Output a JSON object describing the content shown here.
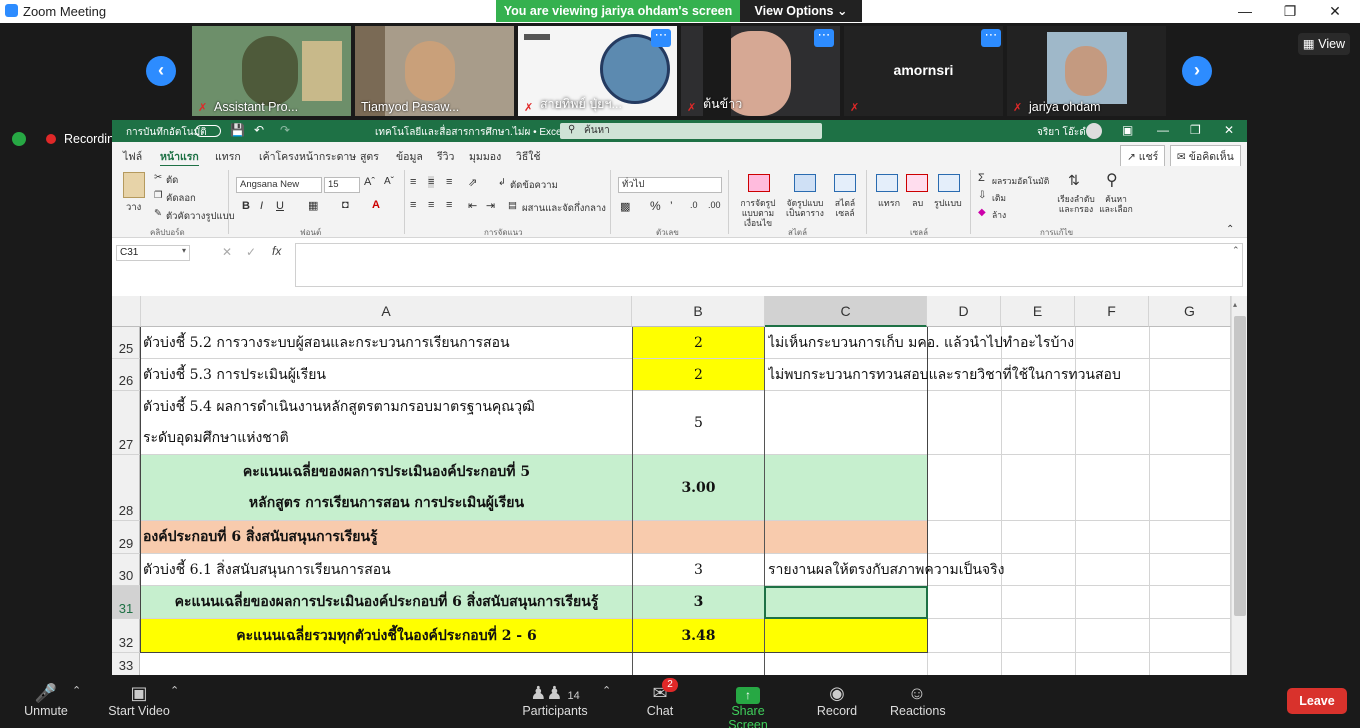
{
  "window": {
    "title": "Zoom Meeting"
  },
  "banner": {
    "message": "You are viewing jariya ohdam's screen",
    "view_options": "View Options"
  },
  "gallery": {
    "tiles": [
      {
        "name": "Assistant Pro..."
      },
      {
        "name": "Tiamyod Pasaw..."
      },
      {
        "name": "สายทิพย์ ปุ่ยฯ..."
      },
      {
        "name": "ต้นข้าว"
      },
      {
        "name": "amornsri"
      },
      {
        "name": "jariya ohdam"
      }
    ],
    "view_label": "View"
  },
  "recording": {
    "label": "Recording"
  },
  "excel": {
    "autosave": "การบันทึกอัตโนมัติ",
    "doc_title": "เทคโนโลยีและสื่อสารการศึกษา.ไม่ผ • Excel",
    "search_placeholder": "ค้นหา",
    "user": "จริยา โอ๊ะดำ",
    "tabs": [
      "ไฟล์",
      "หน้าแรก",
      "แทรก",
      "เค้าโครงหน้ากระดาษ",
      "สูตร",
      "ข้อมูล",
      "รีวิว",
      "มุมมอง",
      "วิธีใช้"
    ],
    "share": "แชร์",
    "comments": "ข้อคิดเห็น",
    "ribbon": {
      "paste": "วาง",
      "cut": "ตัด",
      "copy": "คัดลอก",
      "format_painter": "ตัวคัดวางรูปแบบ",
      "clipboard": "คลิปบอร์ด",
      "font_name": "Angsana New",
      "font_size": "15",
      "font_group": "ฟอนต์",
      "wrap": "ตัดข้อความ",
      "merge": "ผสานและจัดกึ่งกลาง",
      "alignment": "การจัดแนว",
      "number_format": "ทั่วไป",
      "number_group": "ตัวเลข",
      "cond_format": "การจัดรูปแบบตามเงื่อนไข",
      "format_table": "จัดรูปแบบเป็นตาราง",
      "cell_styles": "สไตล์เซลล์",
      "styles_group": "สไตล์",
      "insert": "แทรก",
      "delete": "ลบ",
      "format": "รูปแบบ",
      "cells_group": "เซลล์",
      "autosum": "ผลรวมอัตโนมัติ",
      "fill": "เติม",
      "clear": "ล้าง",
      "sort": "เรียงลำดับและกรอง",
      "find": "ค้นหาและเลือก",
      "editing_group": "การแก้ไข"
    },
    "namebox": "C31",
    "columns": [
      "A",
      "B",
      "C",
      "D",
      "E",
      "F",
      "G"
    ],
    "rows": [
      {
        "num": "25",
        "a": "ตัวบ่งชี้ 5.2 การวางระบบผู้สอนและกระบวนการเรียนการสอน",
        "b": "2",
        "c": "ไม่เห็นกระบวนการเก็บ มคอ. แล้วนำไปทำอะไรบ้าง"
      },
      {
        "num": "26",
        "a": "ตัวบ่งชี้ 5.3 การประเมินผู้เรียน",
        "b": "2",
        "c": "ไม่พบกระบวนการทวนสอบและรายวิชาที่ใช้ในการทวนสอบ"
      },
      {
        "num": "27",
        "a1": "ตัวบ่งชี้ 5.4 ผลการดำเนินงานหลักสูตรตามกรอบมาตรฐานคุณวุฒิ",
        "a2": "ระดับอุดมศึกษาแห่งชาติ",
        "b": "5",
        "c": ""
      },
      {
        "num": "28",
        "a1": "คะแนนเฉลี่ยของผลการประเมินองค์ประกอบที่ 5",
        "a2": "หลักสูตร การเรียนการสอน  การประเมินผู้เรียน",
        "b": "3.00",
        "c": ""
      },
      {
        "num": "29",
        "a": "องค์ประกอบที่ 6 สิ่งสนับสนุนการเรียนรู้",
        "b": "",
        "c": ""
      },
      {
        "num": "30",
        "a": "ตัวบ่งชี้ 6.1 สิ่งสนับสนุนการเรียนการสอน",
        "b": "3",
        "c": "รายงานผลให้ตรงกับสภาพความเป็นจริง"
      },
      {
        "num": "31",
        "a": "คะแนนเฉลี่ยของผลการประเมินองค์ประกอบที่ 6 สิ่งสนับสนุนการเรียนรู้",
        "b": "3",
        "c": ""
      },
      {
        "num": "32",
        "a": "คะแนนเฉลี่ยรวมทุกตัวบ่งชี้ในองค์ประกอบที่ 2 - 6",
        "b": "3.48",
        "c": ""
      },
      {
        "num": "33",
        "a": "",
        "b": "",
        "c": ""
      }
    ],
    "colors": {
      "green_header": "#1e7145",
      "yellow": "#ffff00",
      "light_green": "#c6efce",
      "orange": "#f8cbad"
    }
  },
  "toolbar": {
    "unmute": "Unmute",
    "start_video": "Start Video",
    "participants": "Participants",
    "participants_count": "14",
    "chat": "Chat",
    "chat_badge": "2",
    "share": "Share Screen",
    "record": "Record",
    "reactions": "Reactions",
    "leave": "Leave"
  }
}
